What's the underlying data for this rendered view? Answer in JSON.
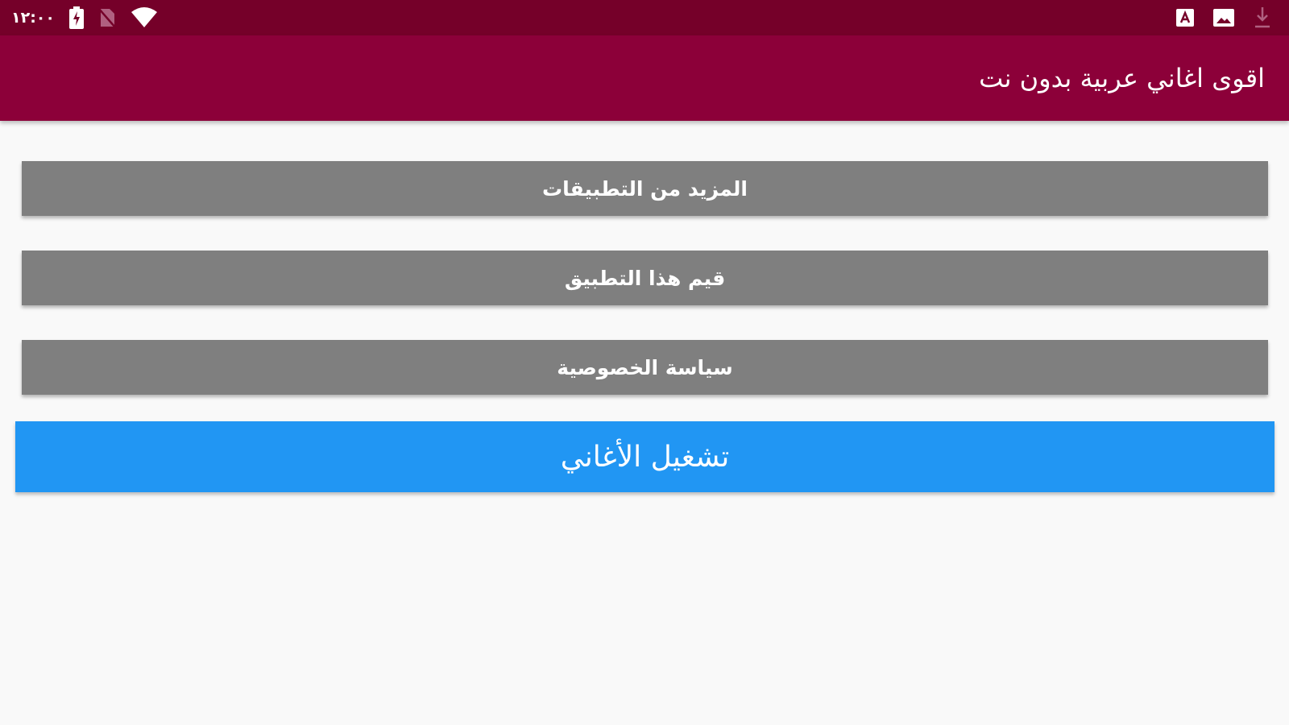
{
  "status_bar": {
    "time": "١٢:٠٠",
    "icons_left": [
      "battery-icon",
      "no-sim-icon",
      "wifi-icon"
    ],
    "icons_right": [
      "font-a-icon",
      "image-icon",
      "download-icon"
    ],
    "background": "#750029"
  },
  "app_bar": {
    "title": "اقوى اغاني عربية بدون نت",
    "background": "#8c0039"
  },
  "buttons": {
    "more_apps": "المزيد من التطبيقات",
    "rate_app": "قيم هذا التطبيق",
    "privacy_policy": "سياسة الخصوصية",
    "play_songs": "تشغيل الأغاني"
  },
  "colors": {
    "gray_button": "#7f7f7f",
    "play_button": "#2196f3",
    "page_background": "#f9f9f9"
  }
}
